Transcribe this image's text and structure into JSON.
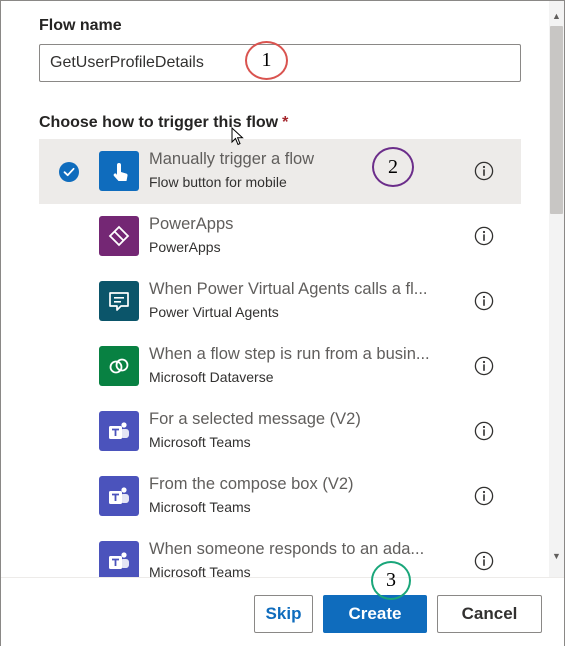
{
  "form": {
    "flow_name_label": "Flow name",
    "flow_name_value": "GetUserProfileDetails",
    "trigger_label": "Choose how to trigger this flow",
    "required_marker": "*"
  },
  "triggers": [
    {
      "title": "Manually trigger a flow",
      "subtitle": "Flow button for mobile",
      "selected": true,
      "icon": "touch-icon",
      "color": "#0f6cbd"
    },
    {
      "title": "PowerApps",
      "subtitle": "PowerApps",
      "selected": false,
      "icon": "powerapps-icon",
      "color": "#742774"
    },
    {
      "title": "When Power Virtual Agents calls a fl...",
      "subtitle": "Power Virtual Agents",
      "selected": false,
      "icon": "chat-bot-icon",
      "color": "#0b556a"
    },
    {
      "title": "When a flow step is run from a busin...",
      "subtitle": "Microsoft Dataverse",
      "selected": false,
      "icon": "dataverse-icon",
      "color": "#088142"
    },
    {
      "title": "For a selected message (V2)",
      "subtitle": "Microsoft Teams",
      "selected": false,
      "icon": "teams-icon",
      "color": "#4b53bc"
    },
    {
      "title": "From the compose box (V2)",
      "subtitle": "Microsoft Teams",
      "selected": false,
      "icon": "teams-icon",
      "color": "#4b53bc"
    },
    {
      "title": "When someone responds to an ada...",
      "subtitle": "Microsoft Teams",
      "selected": false,
      "icon": "teams-icon",
      "color": "#4b53bc"
    }
  ],
  "footer": {
    "skip_label": "Skip",
    "create_label": "Create",
    "cancel_label": "Cancel"
  },
  "annotations": {
    "one": "1",
    "two": "2",
    "three": "3"
  }
}
